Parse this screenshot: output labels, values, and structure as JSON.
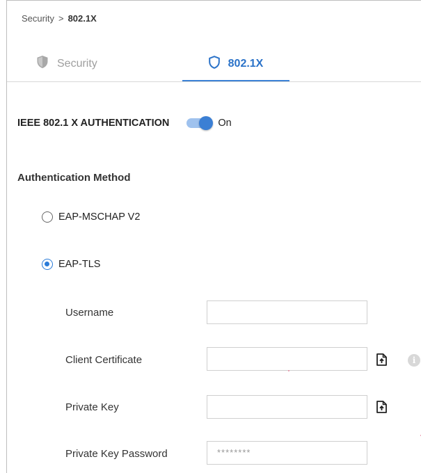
{
  "breadcrumb": {
    "parent": "Security",
    "separator": ">",
    "current": "802.1X"
  },
  "tabs": [
    {
      "label": "Security",
      "icon": "shield-filled-icon",
      "active": false
    },
    {
      "label": "802.1X",
      "icon": "shield-outline-icon",
      "active": true
    }
  ],
  "auth": {
    "label": "IEEE 802.1 X AUTHENTICATION",
    "toggle_state": "On",
    "enabled": true
  },
  "method": {
    "title": "Authentication Method",
    "options": [
      {
        "label": "EAP-MSCHAP V2",
        "checked": false
      },
      {
        "label": "EAP-TLS",
        "checked": true
      }
    ]
  },
  "fields": {
    "username": {
      "label": "Username",
      "value": ""
    },
    "client_certificate": {
      "label": "Client Certificate",
      "value": ""
    },
    "private_key": {
      "label": "Private Key",
      "value": ""
    },
    "private_key_password": {
      "label": "Private Key Password",
      "value": "********"
    }
  },
  "colors": {
    "accent": "#2a72c8",
    "toggle_track": "#9fc2ee",
    "toggle_knob": "#3b7fd4",
    "inactive_tab": "#9e9e9e"
  }
}
